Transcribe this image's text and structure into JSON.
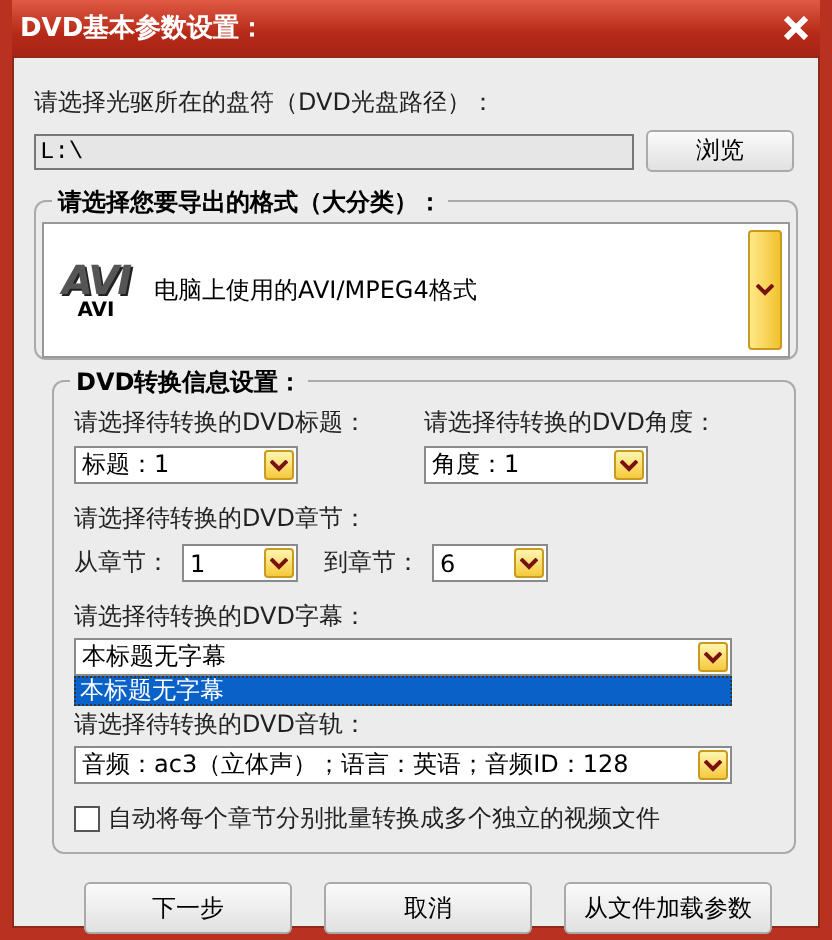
{
  "window": {
    "title": "DVD基本参数设置："
  },
  "drive": {
    "label": "请选择光驱所在的盘符（DVD光盘路径）：",
    "value": "L:\\",
    "browse_button": "浏览"
  },
  "format_group": {
    "legend": "请选择您要导出的格式（大分类）：",
    "logo_text": "AVI",
    "logo_caption": "AVI",
    "value": "电脑上使用的AVI/MPEG4格式"
  },
  "conversion_group": {
    "legend": "DVD转换信息设置：",
    "title": {
      "label": "请选择待转换的DVD标题：",
      "value": "标题：1"
    },
    "angle": {
      "label": "请选择待转换的DVD角度：",
      "value": "角度：1"
    },
    "chapter_label": "请选择待转换的DVD章节：",
    "from_chapter": {
      "label": "从章节：",
      "value": "1"
    },
    "to_chapter": {
      "label": "到章节：",
      "value": "6"
    },
    "subtitle": {
      "label": "请选择待转换的DVD字幕：",
      "value": "本标题无字幕",
      "expanded": true,
      "options": [
        {
          "label": "本标题无字幕",
          "selected": true
        }
      ]
    },
    "audio": {
      "label": "请选择待转换的DVD音轨：",
      "value": "音频：ac3（立体声）；语言：英语；音频ID：128"
    },
    "split_checkbox": {
      "label": "自动将每个章节分别批量转换成多个独立的视频文件",
      "checked": false
    }
  },
  "buttons": [
    "下一步",
    "取消",
    "从文件加载参数"
  ]
}
